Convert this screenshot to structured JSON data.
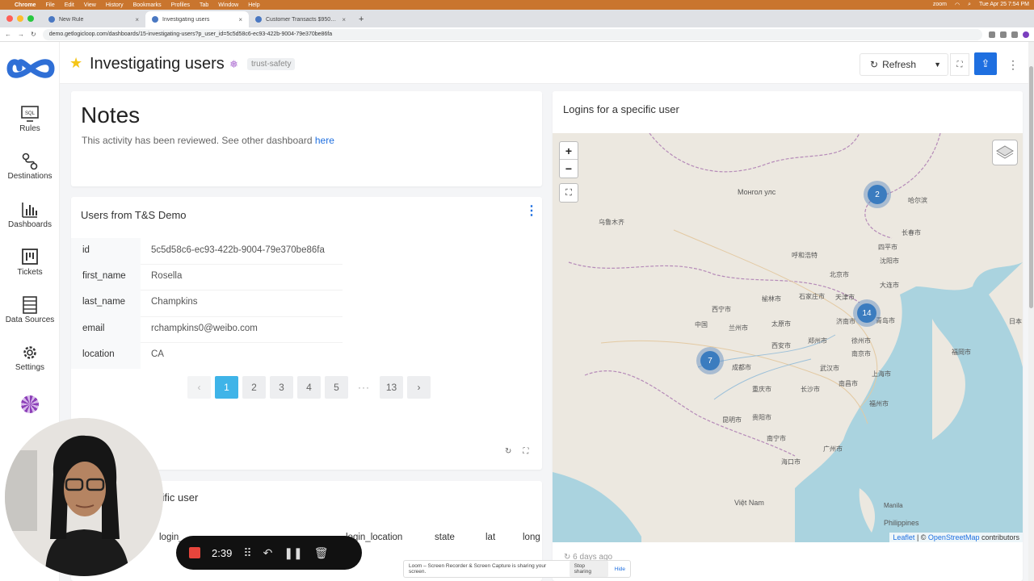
{
  "menubar": {
    "app": "Chrome",
    "items": [
      "File",
      "Edit",
      "View",
      "History",
      "Bookmarks",
      "Profiles",
      "Tab",
      "Window",
      "Help"
    ],
    "status_app": "zoom",
    "clock": "Tue Apr 25  7:54 PM"
  },
  "tabs": [
    {
      "title": "New Rule"
    },
    {
      "title": "Investigating users"
    },
    {
      "title": "Customer Transacts $9500 in..."
    }
  ],
  "address": {
    "url": "demo.getlogicloop.com/dashboards/15-investigating-users?p_user_id=5c5d58c6-ec93-422b-9004-79e370be86fa"
  },
  "sidebar": {
    "items": [
      {
        "label": "Rules"
      },
      {
        "label": "Destinations"
      },
      {
        "label": "Dashboards"
      },
      {
        "label": "Tickets"
      },
      {
        "label": "Data Sources"
      },
      {
        "label": "Settings"
      }
    ]
  },
  "header": {
    "title": "Investigating users",
    "tag": "trust-safety",
    "refresh_label": "Refresh"
  },
  "notes": {
    "title": "Notes",
    "body": "This activity has been reviewed. See other dashboard ",
    "link": "here"
  },
  "users_widget": {
    "title": "Users from T&S Demo",
    "rows": [
      {
        "key": "id",
        "value": "5c5d58c6-ec93-422b-9004-79e370be86fa"
      },
      {
        "key": "first_name",
        "value": "Rosella"
      },
      {
        "key": "last_name",
        "value": "Champkins"
      },
      {
        "key": "email",
        "value": "rchampkins0@weibo.com"
      },
      {
        "key": "location",
        "value": "CA"
      }
    ],
    "pages": [
      "1",
      "2",
      "3",
      "4",
      "5",
      "···",
      "13"
    ],
    "current_page": "1"
  },
  "logins_widget": {
    "title_partial": "cific user",
    "columns": [
      "login_",
      "login_location",
      "state",
      "lat",
      "long"
    ]
  },
  "map_widget": {
    "title": "Logins for a specific user",
    "clusters": [
      {
        "count": "2",
        "lat": 45.8,
        "lon": 126.6
      },
      {
        "count": "14",
        "lat": 36.5,
        "lon": 119.5
      },
      {
        "count": "7",
        "lat": 30.6,
        "lon": 104.1
      }
    ],
    "attribution_leaflet": "Leaflet",
    "attribution_sep": " | © ",
    "attribution_osm": "OpenStreetMap",
    "attribution_tail": " contributors",
    "updated": "6 days ago",
    "city_labels": [
      "Монгол улс",
      "乌鲁木齐",
      "哈尔滨",
      "长春市",
      "呼和浩特",
      "北京市",
      "天津市",
      "沈阳市",
      "四平市",
      "大连市",
      "石家庄市",
      "西宁市",
      "兰州市",
      "榆林市",
      "太原市",
      "济南市",
      "青岛市",
      "西安市",
      "郑州市",
      "徐州市",
      "南京市",
      "上海市",
      "成都市",
      "重庆市",
      "武汉市",
      "长沙市",
      "南昌市",
      "福州市",
      "贵阳市",
      "昆明市",
      "南宁市",
      "广州市",
      "海口市",
      "中国",
      "Việt Nam",
      "Philippines",
      "Manila",
      "日本",
      "福岡市"
    ]
  },
  "recorder": {
    "time": "2:39",
    "banner_text": "Loom – Screen Recorder & Screen Capture is sharing your screen.",
    "stop_label": "Stop sharing",
    "hide_label": "Hide"
  }
}
